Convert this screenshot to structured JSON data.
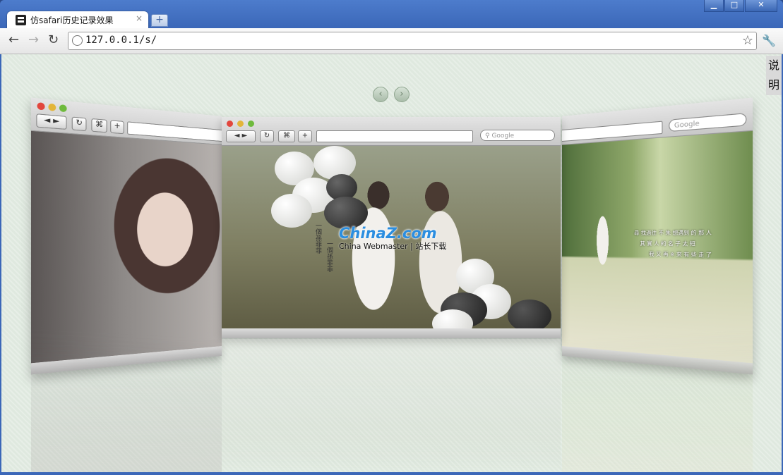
{
  "tab": {
    "title": "仿safari历史记录效果",
    "close": "×",
    "new_tab": "+"
  },
  "window_controls": {
    "minimize": "▁",
    "maximize": "□",
    "close": "✕"
  },
  "toolbar": {
    "back": "←",
    "forward": "→",
    "reload": "↻",
    "url": "127.0.0.1/s/",
    "star": "☆",
    "wrench": "🔧"
  },
  "page": {
    "help_label": "说明",
    "prev_arrow": "‹",
    "next_arrow": "›",
    "cards": [
      {
        "id": "left",
        "search_placeholder": ""
      },
      {
        "id": "center",
        "search_placeholder": "Google",
        "btn_back": "◄ ►",
        "btn_reload": "↻",
        "btn_plus": "+"
      },
      {
        "id": "right",
        "search_placeholder": "Google"
      }
    ],
    "watermark": {
      "main": "ChinaZ.com",
      "sub": "China Webmaster | 站长下载"
    },
    "center_vertical_text": [
      "一個孫菲菲",
      "一個孫菲菲"
    ],
    "right_poem": [
      "尋 找過往 不 朱 想遇到 的 那 人",
      "其 實 人 的 名 子 太 短",
      "我 又 再 ※ 來 有 些 走 了"
    ]
  },
  "colors": {
    "titlebar": "#4d7ccc",
    "content_bg": "#dfe9df",
    "accent": "#2b8ee0"
  }
}
